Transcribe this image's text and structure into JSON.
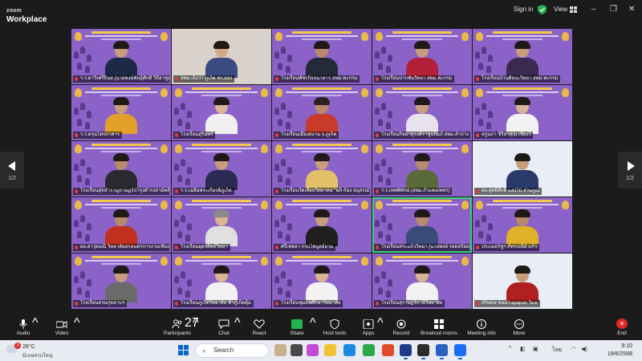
{
  "app": {
    "logo_top": "zoom",
    "logo_bottom": "Workplace",
    "sign_in": "Sign in",
    "view": "View",
    "window_controls": [
      "–",
      "❐",
      "✕"
    ]
  },
  "gallery": {
    "page_left": "1/2",
    "page_right": "1/2",
    "tiles": [
      {
        "name": "ร.ร.ดาวิเศรีธิษส (นายพงษ์พันธุ์ศักดิ์ วิธีอาชูล)",
        "type": "slide",
        "skin": "#c99d7c",
        "hair": "#1e1a18",
        "shirt": "#1c2a48"
      },
      {
        "name": "สพม.เจ็งว่า ภูเก็ต ชร.ยอง",
        "type": "photo",
        "skin": "#d7a886",
        "hair": "#231a16",
        "shirt": "#3b4a80"
      },
      {
        "name": "โรงเรียนพัชรกิจจนาคาร สพม.พะกรม",
        "type": "slide",
        "skin": "#b88a6a",
        "hair": "#1e1a18",
        "shirt": "#252a3a"
      },
      {
        "name": "โรงเรียนปากพันวิทยา สพม.พะกรม",
        "type": "slide",
        "skin": "#c99d7c",
        "hair": "#1e1a18",
        "shirt": "#b2203a"
      },
      {
        "name": "โรงเรียนบ้านศิลปะวิทยา สพม.พะกรม",
        "type": "slide",
        "skin": "#c99d7c",
        "hair": "#1e1a18",
        "shirt": "#3a2a52"
      },
      {
        "name": "ร.ร.ตรุนไพรภาคาร",
        "type": "slide",
        "skin": "#c99d7c",
        "hair": "#1e1a18",
        "shirt": "#e0a02a"
      },
      {
        "name": "โรงเรียนสุรินทร์",
        "type": "slide",
        "skin": "#d9b393",
        "hair": "#1e1a18",
        "shirt": "#f0f0f0"
      },
      {
        "name": "โรงเรียนเมืองสงาน จ.ภูเก็ต",
        "type": "slide",
        "skin": "#b88a6a",
        "hair": "#2a2220",
        "shirt": "#c83a2a"
      },
      {
        "name": "โรงเรียนกิจมาตุรงค์ราชูปถัมภ์ สพม.ลำปาง",
        "type": "slide",
        "skin": "#c99d7c",
        "hair": "#1e1a18",
        "shirt": "#e8e2ee"
      },
      {
        "name": "ครูนภา ขีริสาคุณ เชียงใ",
        "type": "slide",
        "skin": "#d9b393",
        "hair": "#1e1a18",
        "shirt": "#f2f2f2"
      },
      {
        "name": "โรงเรียนสุขสำราญราษฎร์บำรุงดำรงสามัคคี",
        "type": "slide",
        "skin": "#b88a6a",
        "hair": "#1e1a18",
        "shirt": "#2a2a30"
      },
      {
        "name": "ร.ร.เฉลิมพระเกียรติภูเก็ต",
        "type": "slide",
        "skin": "#c99d7c",
        "hair": "#1e1a18",
        "shirt": "#2a2a52"
      },
      {
        "name": "โรงเรียนวัดเลียบวิทยาคม \"อภิ-ก้อง อนุสรณ์\"",
        "type": "slide",
        "skin": "#c99d7c",
        "hair": "#1e1a18",
        "shirt": "#e2c06a"
      },
      {
        "name": "ร.ร.เทพพิทักษ์ (สพม.กำแพงเพชร)",
        "type": "slide",
        "skin": "#b88a6a",
        "hair": "#1e1a18",
        "shirt": "#5a6a3a"
      },
      {
        "name": "ผอ.สุทธิศักดิ์ แสงไป่ ส่วนกูณ",
        "type": "plain",
        "skin": "#c99d7c",
        "hair": "#1e1a18",
        "shirt": "#2a3a6a"
      },
      {
        "name": "ผอ.สาวุ่ยมณี วิทยาลัยสกลนครการงานเชียงใหม่",
        "type": "slide",
        "skin": "#b88a6a",
        "hair": "#1e1a18",
        "shirt": "#c0301e"
      },
      {
        "name": "โรงเรียนอุตรดิตถ์วิทยา",
        "type": "slide",
        "skin": "#d9b393",
        "hair": "#8a8a8a",
        "shirt": "#e0e0e0"
      },
      {
        "name": "ศรีเทพลา กรบไพบูลย์ยาม",
        "type": "slide",
        "skin": "#c99d7c",
        "hair": "#1e1a18",
        "shirt": "#202020"
      },
      {
        "name": "โรงเรียนสระแก้ววิทยา (นายพงษ์ รอดสร้อย)",
        "type": "slide",
        "skin": "#b88a6a",
        "hair": "#1e1a18",
        "shirt": "#3a4a7a",
        "active": true
      },
      {
        "name": "ประเมอร์ชูฯ ภัทรเอนีย์ แก้ว",
        "type": "slide",
        "skin": "#b88a6a",
        "hair": "#1e1a18",
        "shirt": "#e0b02a"
      },
      {
        "name": "โรงเรียนสวนกุหลาบฯ",
        "type": "slide",
        "skin": "#c99d7c",
        "hair": "#1e1a18",
        "shirt": "#6a6a6a"
      },
      {
        "name": "โรงเรียนภูเก็ตวิทยาลัย ฟ้าภูเก็ตคุ้ม",
        "type": "slide",
        "skin": "#d9b393",
        "hair": "#1e1a18",
        "shirt": "#f2f2f2"
      },
      {
        "name": "โรงเรียนชุมแพศึกษาวิทยาลัย",
        "type": "slide",
        "skin": "#d9b393",
        "hair": "#1e1a18",
        "shirt": "#f2f2f2"
      },
      {
        "name": "โรงเรียนสุราษฎร์ธานีวิทยาลัย",
        "type": "slide",
        "skin": "#d9b393",
        "hair": "#1e1a18",
        "shirt": "#f2f2f2"
      },
      {
        "name": "iPhone ของPrapapan วิมล",
        "type": "plain",
        "skin": "#c99d7c",
        "hair": "#1e1a18",
        "shirt": "#b02020"
      }
    ]
  },
  "toolbar": {
    "audio": "Audio",
    "video": "Video",
    "participants": "Participants",
    "participants_count": "27",
    "chat": "Chat",
    "react": "React",
    "share": "Share",
    "host_tools": "Host tools",
    "apps": "Apps",
    "record": "Record",
    "breakout_rooms": "Breakout rooms",
    "meeting_info": "Meeting info",
    "more": "More",
    "end": "End"
  },
  "taskbar": {
    "weather_temp": "26°C",
    "weather_desc": "มีเมฆส่วนใหญ่",
    "weather_badge": "3",
    "search": "Search",
    "lang": "ไทย",
    "time": "9:10",
    "date": "19/6/2568"
  },
  "colors": {
    "tile_purple": "#8b62c7",
    "active_border": "#37d67a",
    "end_red": "#e02828",
    "share_green": "#23b450"
  }
}
